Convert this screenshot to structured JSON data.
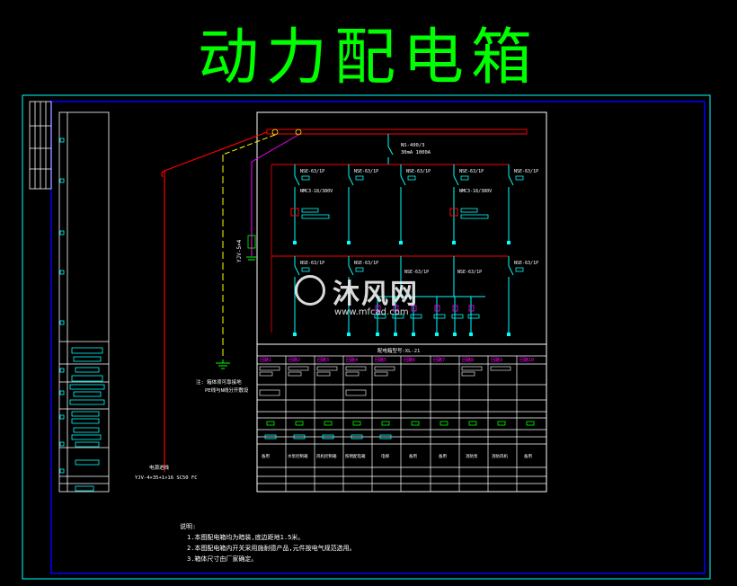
{
  "title": "动力配电箱",
  "colors": {
    "title": "#00ff00",
    "frame_outer": "#00ffff",
    "frame_inner": "#0000ff",
    "bus": "#ff0000",
    "circuit": "#00ffff",
    "pe_line": "#ff00ff",
    "neutral_line": "#ffff00",
    "table_header": "#ff00ff",
    "text": "#ffffff",
    "ground": "#00ff00"
  },
  "incoming": {
    "breaker_label": "NS-400/3",
    "breaker_sub": "30mA 1000A"
  },
  "branches_top": [
    {
      "breaker": "NSE-63/1P"
    },
    {
      "breaker": "NSE-63/1P"
    },
    {
      "breaker": "NSE-63/1P"
    },
    {
      "breaker": "NSE-63/1P"
    },
    {
      "breaker": "NSE-63/1P"
    }
  ],
  "contactor_labels": [
    "NMC3-18/380V",
    "NMC3-18/380V"
  ],
  "branches_bottom": [
    {
      "breaker": "NSE-63/1P"
    },
    {
      "breaker": "NSE-63/1P"
    },
    {
      "breaker": "NSE-63/1P"
    }
  ],
  "rcd_labels": [
    "NSE-63/1P",
    "NSE-63/1P"
  ],
  "feeder_label": "YJV-5×4",
  "schedule_title": "配电箱型号:XL-21",
  "table_headers": [
    "回路1",
    "回路2",
    "回路3",
    "回路4",
    "回路5",
    "回路6",
    "回路7",
    "回路8",
    "回路9",
    "回路10"
  ],
  "load_names": [
    "备用",
    "水泵控制箱",
    "风机控制箱",
    "照明配电箱",
    "电梯",
    "备用",
    "备用",
    "消防泵",
    "消防风机",
    "备用"
  ],
  "ground_note": "注: 箱体须可靠接地",
  "ground_note2": "PE线与N线分开敷设",
  "source_note": "电源进线",
  "source_note2": "YJV-4×35+1×16 SC50 FC",
  "notes_heading": "说明:",
  "notes": [
    "1.本图配电箱均为暗装,底边距地1.5米。",
    "2.本图配电箱内开关采用施耐德产品,元件按电气规范选用。",
    "3.箱体尺寸由厂家确定。"
  ],
  "watermark": {
    "brand": "沐风网",
    "url": "www.mfcad.com"
  }
}
